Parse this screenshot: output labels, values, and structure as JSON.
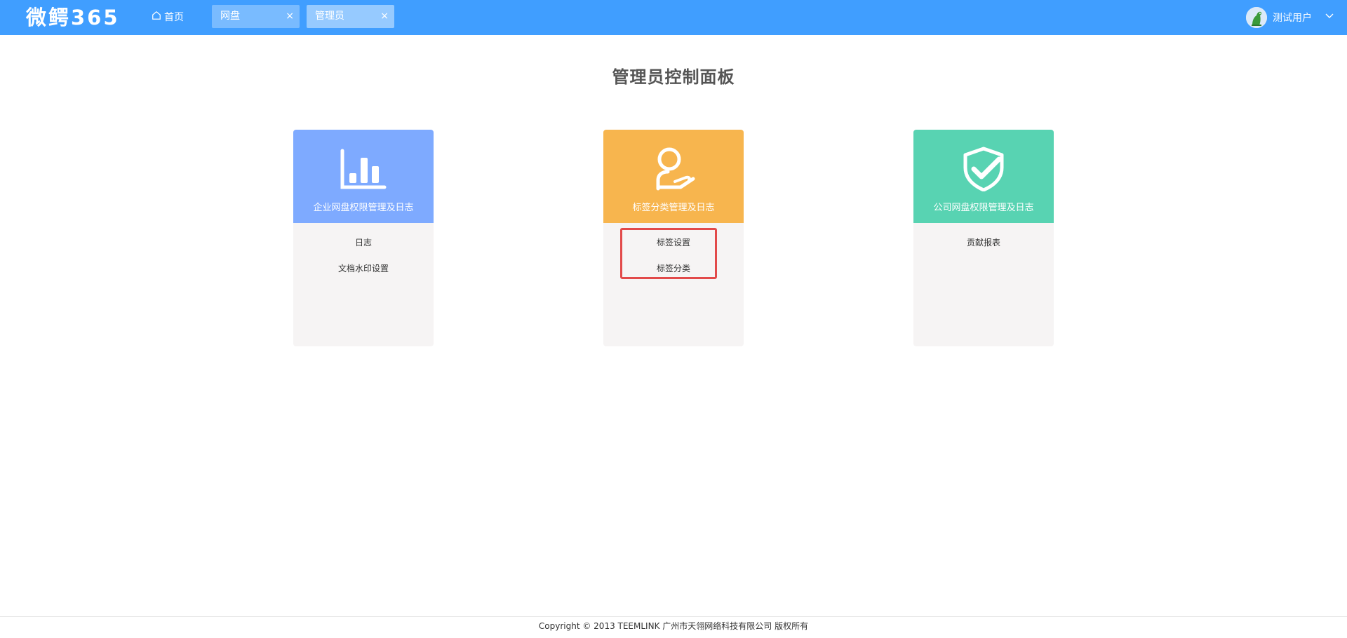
{
  "header": {
    "logo": "微鳄365",
    "home_label": "首页",
    "tabs": [
      {
        "label": "网盘",
        "close": "×"
      },
      {
        "label": "管理员",
        "close": "×"
      }
    ],
    "user_name": "测试用户",
    "bg_color": "#409eff"
  },
  "main": {
    "title": "管理员控制面板",
    "cards": [
      {
        "title": "企业网盘权限管理及日志",
        "icon": "bar-chart-icon",
        "color": "#7eaaff",
        "items": [
          "日志",
          "文档水印设置"
        ]
      },
      {
        "title": "标签分类管理及日志",
        "icon": "person-hand-icon",
        "color": "#f7b54e",
        "items": [
          "标签设置",
          "标签分类"
        ]
      },
      {
        "title": "公司网盘权限管理及日志",
        "icon": "shield-check-icon",
        "color": "#58d3b2",
        "items": [
          "贡献报表"
        ]
      }
    ]
  },
  "footer": {
    "copyright": "Copyright © 2013 TEEMLINK 广州市天翎网络科技有限公司 版权所有"
  }
}
